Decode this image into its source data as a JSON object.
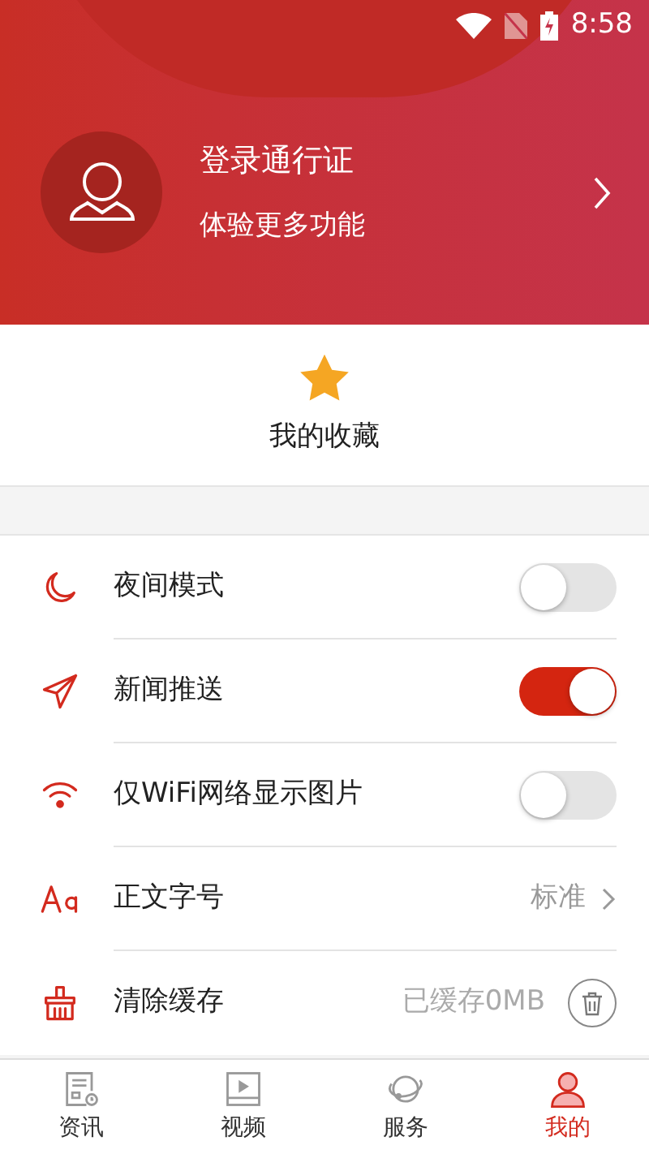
{
  "status_bar": {
    "time": "8:58"
  },
  "profile": {
    "title": "登录通行证",
    "subtitle": "体验更多功能"
  },
  "favorites": {
    "label": "我的收藏"
  },
  "settings": [
    {
      "kind": "toggle",
      "label": "夜间模式",
      "on": false
    },
    {
      "kind": "toggle",
      "label": "新闻推送",
      "on": true
    },
    {
      "kind": "toggle",
      "label": "仅WiFi网络显示图片",
      "on": false
    },
    {
      "kind": "value",
      "label": "正文字号",
      "value": "标准"
    },
    {
      "kind": "cache",
      "label": "清除缓存",
      "value": "已缓存0MB"
    }
  ],
  "tabs": [
    {
      "label": "资讯",
      "selected": false
    },
    {
      "label": "视频",
      "selected": false
    },
    {
      "label": "服务",
      "selected": false
    },
    {
      "label": "我的",
      "selected": true
    }
  ]
}
